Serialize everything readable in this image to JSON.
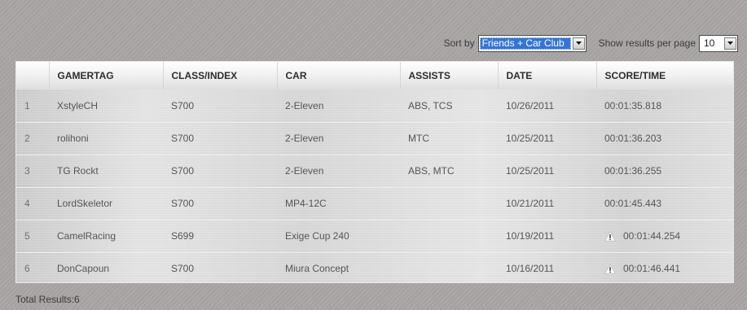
{
  "controls": {
    "sort_label": "Sort by",
    "sort_value": "Friends + Car Club",
    "per_page_label": "Show results per page",
    "per_page_value": "10"
  },
  "table": {
    "headers": [
      "",
      "GAMERTAG",
      "CLASS/INDEX",
      "CAR",
      "ASSISTS",
      "DATE",
      "SCORE/TIME"
    ],
    "rows": [
      {
        "rank": "1",
        "gamertag": "XstyleCH",
        "class": "S700",
        "car": "2-Eleven",
        "assists": "ABS, TCS",
        "date": "10/26/2011",
        "time": "00:01:35.818",
        "warning": false
      },
      {
        "rank": "2",
        "gamertag": "rolihoni",
        "class": "S700",
        "car": "2-Eleven",
        "assists": "MTC",
        "date": "10/25/2011",
        "time": "00:01:36.203",
        "warning": false
      },
      {
        "rank": "3",
        "gamertag": "TG Rockt",
        "class": "S700",
        "car": "2-Eleven",
        "assists": "ABS, MTC",
        "date": "10/25/2011",
        "time": "00:01:36.255",
        "warning": false
      },
      {
        "rank": "4",
        "gamertag": "LordSkeletor",
        "class": "S700",
        "car": "MP4-12C",
        "assists": "",
        "date": "10/21/2011",
        "time": "00:01:45.443",
        "warning": false
      },
      {
        "rank": "5",
        "gamertag": "CamelRacing",
        "class": "S699",
        "car": "Exige Cup 240",
        "assists": "",
        "date": "10/19/2011",
        "time": "00:01:44.254",
        "warning": true
      },
      {
        "rank": "6",
        "gamertag": "DonCapoun",
        "class": "S700",
        "car": "Miura Concept",
        "assists": "",
        "date": "10/16/2011",
        "time": "00:01:46.441",
        "warning": true
      }
    ]
  },
  "footer": {
    "total_results": "Total Results:6"
  },
  "icons": {
    "dropdown": "chevron-down-icon",
    "warning": "warning-icon"
  },
  "colors": {
    "select_highlight": "#3375d6",
    "warning_icon": "#ffffff"
  }
}
